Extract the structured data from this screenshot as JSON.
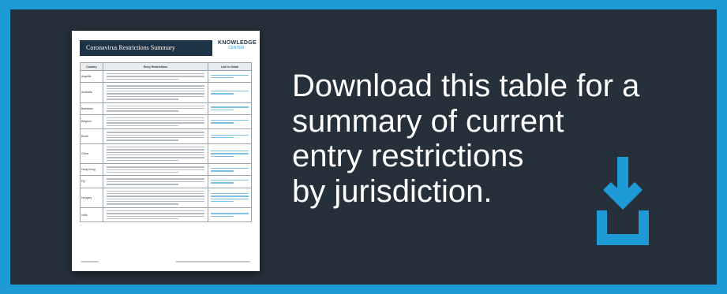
{
  "document": {
    "title": "Coronavirus Restrictions Summary",
    "logo": {
      "top": "KNOWLEDGE",
      "bottom": "CENTER"
    },
    "columns": [
      "Country",
      "Entry Restrictions",
      "Link to Detail"
    ],
    "rows": [
      {
        "name": "Anguilla",
        "lines": 3,
        "links": 2
      },
      {
        "name": "Australia",
        "lines": 6,
        "links": 2
      },
      {
        "name": "Barbados",
        "lines": 3,
        "links": 2
      },
      {
        "name": "Belgium",
        "lines": 4,
        "links": 2
      },
      {
        "name": "Brazil",
        "lines": 4,
        "links": 2
      },
      {
        "name": "China",
        "lines": 6,
        "links": 3
      },
      {
        "name": "Hong Kong",
        "lines": 3,
        "links": 2
      },
      {
        "name": "Fiji",
        "lines": 3,
        "links": 2
      },
      {
        "name": "Hungary",
        "lines": 6,
        "links": 4
      },
      {
        "name": "India",
        "lines": 4,
        "links": 2
      }
    ]
  },
  "headline": {
    "lines": [
      "Download this table for a",
      "summary of current",
      "entry restrictions",
      "by jurisdiction."
    ]
  },
  "icon": {
    "name": "download-icon"
  },
  "colors": {
    "border": "#1e9ad6",
    "panel": "#25303b",
    "accent": "#1e9ad6",
    "text": "#ffffff"
  }
}
